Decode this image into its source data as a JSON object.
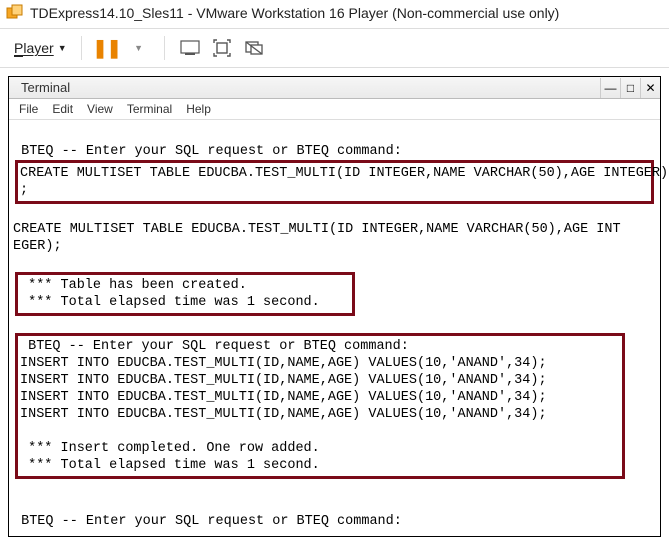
{
  "window": {
    "title": "TDExpress14.10_Sles11 - VMware Workstation 16 Player (Non-commercial use only)"
  },
  "toolbar": {
    "player_label": "Player"
  },
  "terminal": {
    "title": "Terminal",
    "menu": {
      "file": "File",
      "edit": "Edit",
      "view": "View",
      "terminal": "Terminal",
      "help": "Help"
    },
    "lines": {
      "prompt1": " BTEQ -- Enter your SQL request or BTEQ command:",
      "box1_l1": "CREATE MULTISET TABLE EDUCBA.TEST_MULTI(ID INTEGER,NAME VARCHAR(50),AGE INTEGER)",
      "box1_l2": ";",
      "create_echo_l1": "CREATE MULTISET TABLE EDUCBA.TEST_MULTI(ID INTEGER,NAME VARCHAR(50),AGE INT",
      "create_echo_l2": "EGER);",
      "box2_l1": " *** Table has been created.",
      "box2_l2": " *** Total elapsed time was 1 second.",
      "box3_prompt": " BTEQ -- Enter your SQL request or BTEQ command:",
      "box3_ins1": "INSERT INTO EDUCBA.TEST_MULTI(ID,NAME,AGE) VALUES(10,'ANAND',34);",
      "box3_ins2": "INSERT INTO EDUCBA.TEST_MULTI(ID,NAME,AGE) VALUES(10,'ANAND',34);",
      "box3_ins3": "INSERT INTO EDUCBA.TEST_MULTI(ID,NAME,AGE) VALUES(10,'ANAND',34);",
      "box3_ins4": "INSERT INTO EDUCBA.TEST_MULTI(ID,NAME,AGE) VALUES(10,'ANAND',34);",
      "box3_res1": " *** Insert completed. One row added.",
      "box3_res2": " *** Total elapsed time was 1 second.",
      "prompt_last": " BTEQ -- Enter your SQL request or BTEQ command:"
    }
  }
}
